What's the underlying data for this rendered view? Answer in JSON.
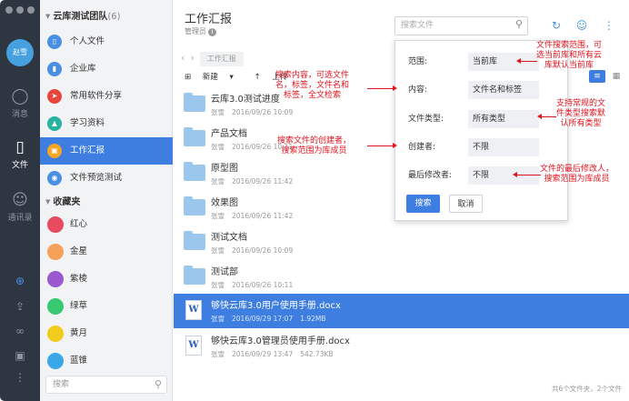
{
  "window": {
    "controls": [
      "close",
      "minimize",
      "zoom"
    ]
  },
  "user": {
    "avatar_text": "赵雪"
  },
  "rail": {
    "items": [
      {
        "label": "消息",
        "icon": "chat-bubble-icon"
      },
      {
        "label": "文件",
        "icon": "file-icon"
      },
      {
        "label": "通讯录",
        "icon": "contacts-icon"
      }
    ],
    "tools": [
      "add-icon",
      "upload-icon",
      "link-icon",
      "lock-icon",
      "more-icon"
    ]
  },
  "sidebar": {
    "team_name": "云库测试团队",
    "team_count": "(6)",
    "groups": [
      {
        "label": "个人文件",
        "color": "#4a90e2",
        "icon": "person-folder-icon"
      },
      {
        "label": "企业库",
        "color": "#4a90e2",
        "icon": "building-icon"
      },
      {
        "label": "常用软件分享",
        "color": "#e8463c",
        "icon": "share-icon"
      },
      {
        "label": "学习资料",
        "color": "#27b2a2",
        "icon": "graduation-icon"
      },
      {
        "label": "工作汇报",
        "color": "#f5a623",
        "icon": "briefcase-icon"
      },
      {
        "label": "文件预览测试",
        "color": "#4a90e2",
        "icon": "eye-icon"
      }
    ],
    "favorites_title": "收藏夹",
    "favorites": [
      {
        "label": "红心",
        "color": "#e84a5f"
      },
      {
        "label": "金星",
        "color": "#f4a259"
      },
      {
        "label": "紫棱",
        "color": "#9b59d0"
      },
      {
        "label": "绿草",
        "color": "#37c871"
      },
      {
        "label": "黄月",
        "color": "#f2cc1c"
      },
      {
        "label": "蓝锥",
        "color": "#3aa8e8"
      }
    ],
    "search_placeholder": "搜索"
  },
  "header": {
    "title": "工作汇报",
    "role": "管理员",
    "search_placeholder": "搜索文件",
    "toolbar_icons": [
      "sync-icon",
      "add-member-icon",
      "more-vertical-icon"
    ]
  },
  "nav": {
    "back": "‹",
    "forward": "›",
    "breadcrumb": "工作汇报"
  },
  "actions": {
    "new": "新建",
    "upload": "上传"
  },
  "files": [
    {
      "type": "folder",
      "name": "云库3.0测试进度",
      "owner": "张雪",
      "date": "2016/09/26 10:09",
      "size": ""
    },
    {
      "type": "folder",
      "name": "产品文档",
      "owner": "张雪",
      "date": "2016/09/26 10:11",
      "size": ""
    },
    {
      "type": "folder",
      "name": "原型图",
      "owner": "张雪",
      "date": "2016/09/26 11:42",
      "size": ""
    },
    {
      "type": "folder",
      "name": "效果图",
      "owner": "张雪",
      "date": "2016/09/26 11:42",
      "size": ""
    },
    {
      "type": "folder",
      "name": "测试文档",
      "owner": "张雪",
      "date": "2016/09/26 10:09",
      "size": ""
    },
    {
      "type": "folder",
      "name": "测试部",
      "owner": "张雪",
      "date": "2016/09/26 10:11",
      "size": ""
    },
    {
      "type": "docx",
      "name": "够快云库3.0用户使用手册.docx",
      "owner": "张雪",
      "date": "2016/09/29 17:07",
      "size": "1.92MB",
      "selected": true
    },
    {
      "type": "docx",
      "name": "够快云库3.0管理员使用手册.docx",
      "owner": "张雪",
      "date": "2016/09/29 13:47",
      "size": "542.73KB"
    }
  ],
  "footer": "共6个文件夹，2个文件",
  "search_popup": {
    "fields": [
      {
        "label": "范围:",
        "value": "当前库"
      },
      {
        "label": "内容:",
        "value": "文件名和标签"
      },
      {
        "label": "文件类型:",
        "value": "所有类型"
      },
      {
        "label": "创建者:",
        "value": "不限"
      },
      {
        "label": "最后修改者:",
        "value": "不限"
      }
    ],
    "search_button": "搜索",
    "cancel_button": "取消"
  },
  "annotations": [
    {
      "lines": [
        "文件搜索范围，可",
        "选当前库和所有云",
        "库默认当前库"
      ]
    },
    {
      "lines": [
        "搜索内容，可选文件",
        "名，标签，文件名和",
        "标签，全文检索"
      ]
    },
    {
      "lines": [
        "支持常规的文",
        "件类型搜索默",
        "认所有类型"
      ]
    },
    {
      "lines": [
        "搜索文件的创建者，",
        "搜索范围为库成员"
      ]
    },
    {
      "lines": [
        "文件的最后修改人，",
        "搜索范围为库成员"
      ]
    }
  ]
}
